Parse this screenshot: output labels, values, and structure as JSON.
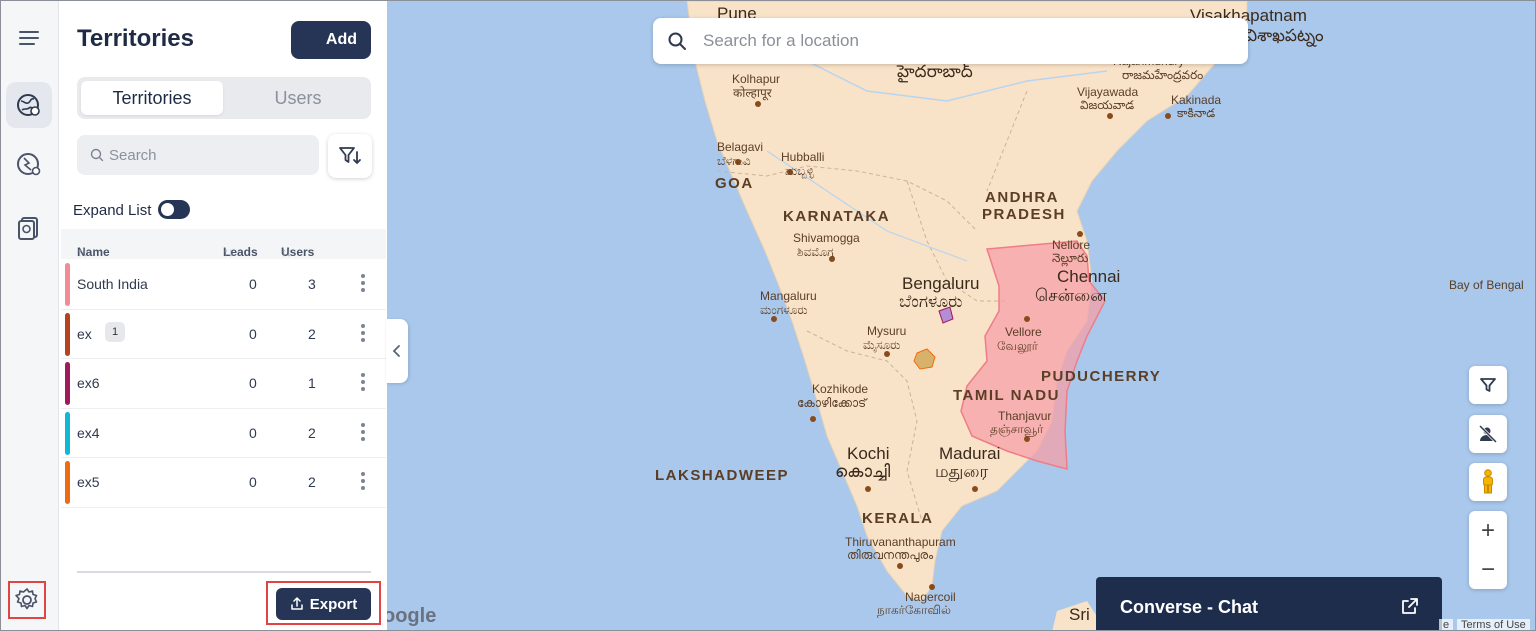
{
  "panel": {
    "title": "Territories",
    "add_label": "Add",
    "tabs": [
      {
        "label": "Territories",
        "active": true
      },
      {
        "label": "Users",
        "active": false
      }
    ],
    "search_placeholder": "Search",
    "expand_label": "Expand List",
    "columns": {
      "name": "Name",
      "leads": "Leads",
      "users": "Users",
      "sort_glyph": "↑↓"
    },
    "rows": [
      {
        "name": "South India",
        "badge": "",
        "leads": "0",
        "users": "3",
        "color": "#f28b95"
      },
      {
        "name": "ex",
        "badge": "1",
        "leads": "0",
        "users": "2",
        "color": "#b5441e"
      },
      {
        "name": "ex6",
        "badge": "",
        "leads": "0",
        "users": "1",
        "color": "#a0195a"
      },
      {
        "name": "ex4",
        "badge": "",
        "leads": "0",
        "users": "2",
        "color": "#11b7d6"
      },
      {
        "name": "ex5",
        "badge": "",
        "leads": "0",
        "users": "2",
        "color": "#f06a12"
      }
    ],
    "export_label": "Export"
  },
  "map": {
    "search_placeholder": "Search for a location",
    "labels": {
      "pune": "Pune",
      "visakhapatnam": "Visakhapatnam",
      "visakhapatnam_local": "విశాఖపట్నం",
      "hyderabad_local": "హైదరాబాద్",
      "kolhapur": "Kolhapur",
      "kolhapur_local": "कोल्हापूर",
      "rajahmundry": "Rajahmundry",
      "rajahmundry_local": "రాజమహేంద్రవరం",
      "vijayawada": "Vijayawada",
      "vijayawada_local": "విజయవాడ",
      "kakinada": "Kakinada",
      "kakinada_local": "కాకినాడ",
      "belagavi": "Belagavi",
      "belagavi_local": "ಬೆಳಗಾವಿ",
      "hubballi": "Hubballi",
      "hubballi_local": "ಹುಬ್ಬಳ್ಳಿ",
      "goa": "GOA",
      "andhra": "ANDHRA",
      "pradesh": "PRADESH",
      "karnataka": "KARNATAKA",
      "shivamogga": "Shivamogga",
      "shivamogga_local": "ಶಿವಮೊಗ್ಗ",
      "nellore": "Nellore",
      "nellore_local": "నెల్లూరు",
      "chennai": "Chennai",
      "chennai_local": "சென்னை",
      "bay_of_bengal": "Bay of Bengal",
      "bengaluru": "Bengaluru",
      "bengaluru_local": "ಬೆಂಗಳೂರು",
      "mangaluru": "Mangaluru",
      "mangaluru_local": "ಮಂಗಳೂರು",
      "mysuru": "Mysuru",
      "mysuru_local": "ಮೈಸೂರು",
      "vellore": "Vellore",
      "vellore_local": "வேலூர்",
      "puducherry": "PUDUCHERRY",
      "kozhikode": "Kozhikode",
      "kozhikode_local": "കോഴിക്കോട്",
      "tamil_nadu": "TAMIL NADU",
      "thanjavur": "Thanjavur",
      "thanjavur_local": "தஞ்சாவூர்",
      "lakshadweep": "LAKSHADWEEP",
      "kochi": "Kochi",
      "kochi_local": "കൊച്ചി",
      "madurai": "Madurai",
      "madurai_local": "மதுரை",
      "kerala": "KERALA",
      "thiruvananthapuram": "Thiruvananthapuram",
      "thiruvananthapuram_local": "തിരുവനന്തപുരം",
      "nagercoil": "Nagercoil",
      "nagercoil_local": "நாகர்கோவில்",
      "sri": "Sri"
    },
    "google": "oogle",
    "terms_left": "e",
    "terms": "Terms of Use"
  },
  "chat": {
    "label": "Converse - Chat"
  },
  "icons": {
    "menu": "menu-icon",
    "territories": "globe-pin-icon",
    "routes": "route-pin-icon",
    "leads": "document-icon",
    "settings": "gear-icon",
    "filter": "filter-sort-icon",
    "export": "share-icon",
    "collapse": "chevron-left-icon",
    "map_filter": "filter-icon",
    "hide_users": "user-hidden-icon",
    "street_view": "pegman-icon",
    "external": "external-link-icon"
  },
  "colors": {
    "accent": "#263556",
    "territory_fill": "#f5a0a8",
    "ocean": "#a9c8ec",
    "land": "#f9e3c8"
  }
}
